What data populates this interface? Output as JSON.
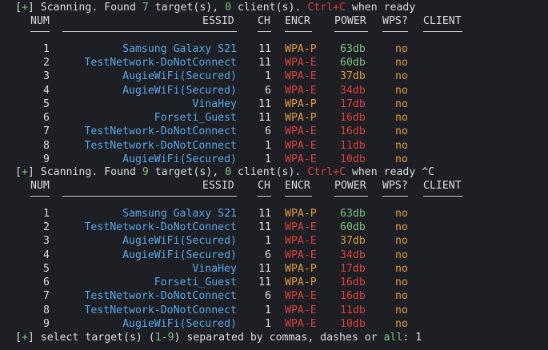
{
  "blocks": [
    {
      "status": {
        "bracket_open": "[",
        "plus": "+",
        "bracket_close": "]",
        "text1": " Scanning. Found ",
        "targets": "7",
        "text2": " target(s), ",
        "clients": "0",
        "text3": " client(s). ",
        "ctrlc": "Ctrl+C",
        "text4": " when ready",
        "suffix": ""
      },
      "headers": {
        "num": "NUM",
        "essid": "ESSID",
        "ch": "CH",
        "encr": "ENCR",
        "power": "POWER",
        "wps": "WPS?",
        "client": "CLIENT"
      },
      "rows": [
        {
          "num": "1",
          "essid": "Samsung Galaxy S21",
          "ch": "11",
          "encr": "WPA-P",
          "power": "63db",
          "wps": "no",
          "encr_color": "#e09a3e",
          "power_color": "#7ec27e"
        },
        {
          "num": "2",
          "essid": "TestNetwork-DoNotConnect",
          "ch": "11",
          "encr": "WPA-E",
          "power": "60db",
          "wps": "no",
          "encr_color": "#d9413a",
          "power_color": "#7ec27e"
        },
        {
          "num": "3",
          "essid": "AugieWiFi(Secured)",
          "ch": "1",
          "encr": "WPA-E",
          "power": "37db",
          "wps": "no",
          "encr_color": "#d9413a",
          "power_color": "#e09a3e"
        },
        {
          "num": "4",
          "essid": "AugieWiFi(Secured)",
          "ch": "6",
          "encr": "WPA-E",
          "power": "34db",
          "wps": "no",
          "encr_color": "#d9413a",
          "power_color": "#d9413a"
        },
        {
          "num": "5",
          "essid": "VinaHey",
          "ch": "11",
          "encr": "WPA-P",
          "power": "17db",
          "wps": "no",
          "encr_color": "#e09a3e",
          "power_color": "#d9413a"
        },
        {
          "num": "6",
          "essid": "Forseti_Guest",
          "ch": "11",
          "encr": "WPA-P",
          "power": "16db",
          "wps": "no",
          "encr_color": "#e09a3e",
          "power_color": "#d9413a"
        },
        {
          "num": "7",
          "essid": "TestNetwork-DoNotConnect",
          "ch": "6",
          "encr": "WPA-E",
          "power": "16db",
          "wps": "no",
          "encr_color": "#d9413a",
          "power_color": "#d9413a"
        },
        {
          "num": "8",
          "essid": "TestNetwork-DoNotConnect",
          "ch": "1",
          "encr": "WPA-E",
          "power": "11db",
          "wps": "no",
          "encr_color": "#d9413a",
          "power_color": "#d9413a"
        },
        {
          "num": "9",
          "essid": "AugieWiFi(Secured)",
          "ch": "1",
          "encr": "WPA-E",
          "power": "10db",
          "wps": "no",
          "encr_color": "#d9413a",
          "power_color": "#d9413a"
        }
      ]
    },
    {
      "status": {
        "bracket_open": "[",
        "plus": "+",
        "bracket_close": "]",
        "text1": " Scanning. Found ",
        "targets": "9",
        "text2": " target(s), ",
        "clients": "0",
        "text3": " client(s). ",
        "ctrlc": "Ctrl+C",
        "text4": " when ready",
        "suffix": " ^C"
      },
      "headers": {
        "num": "NUM",
        "essid": "ESSID",
        "ch": "CH",
        "encr": "ENCR",
        "power": "POWER",
        "wps": "WPS?",
        "client": "CLIENT"
      },
      "rows": [
        {
          "num": "1",
          "essid": "Samsung Galaxy S21",
          "ch": "11",
          "encr": "WPA-P",
          "power": "63db",
          "wps": "no",
          "encr_color": "#e09a3e",
          "power_color": "#7ec27e"
        },
        {
          "num": "2",
          "essid": "TestNetwork-DoNotConnect",
          "ch": "11",
          "encr": "WPA-E",
          "power": "60db",
          "wps": "no",
          "encr_color": "#d9413a",
          "power_color": "#7ec27e"
        },
        {
          "num": "3",
          "essid": "AugieWiFi(Secured)",
          "ch": "1",
          "encr": "WPA-E",
          "power": "37db",
          "wps": "no",
          "encr_color": "#d9413a",
          "power_color": "#e09a3e"
        },
        {
          "num": "4",
          "essid": "AugieWiFi(Secured)",
          "ch": "6",
          "encr": "WPA-E",
          "power": "34db",
          "wps": "no",
          "encr_color": "#d9413a",
          "power_color": "#d9413a"
        },
        {
          "num": "5",
          "essid": "VinaHey",
          "ch": "11",
          "encr": "WPA-P",
          "power": "17db",
          "wps": "no",
          "encr_color": "#e09a3e",
          "power_color": "#d9413a"
        },
        {
          "num": "6",
          "essid": "Forseti_Guest",
          "ch": "11",
          "encr": "WPA-P",
          "power": "16db",
          "wps": "no",
          "encr_color": "#e09a3e",
          "power_color": "#d9413a"
        },
        {
          "num": "7",
          "essid": "TestNetwork-DoNotConnect",
          "ch": "6",
          "encr": "WPA-E",
          "power": "16db",
          "wps": "no",
          "encr_color": "#d9413a",
          "power_color": "#d9413a"
        },
        {
          "num": "8",
          "essid": "TestNetwork-DoNotConnect",
          "ch": "1",
          "encr": "WPA-E",
          "power": "11db",
          "wps": "no",
          "encr_color": "#d9413a",
          "power_color": "#d9413a"
        },
        {
          "num": "9",
          "essid": "AugieWiFi(Secured)",
          "ch": "1",
          "encr": "WPA-E",
          "power": "10db",
          "wps": "no",
          "encr_color": "#d9413a",
          "power_color": "#d9413a"
        }
      ]
    }
  ],
  "prompt": {
    "bracket_open": "[",
    "plus": "+",
    "bracket_close": "]",
    "text1": " select target(s) (",
    "range": "1-9",
    "text2": ") separated by commas, dashes or ",
    "all": "all",
    "text3": ": ",
    "input_value": "1"
  },
  "colors": {
    "background": "#1d1f25",
    "text": "#dcdcdc",
    "green": "#7ec27e",
    "blue": "#5aa7e6",
    "orange": "#e09a3e",
    "red": "#d9413a"
  }
}
